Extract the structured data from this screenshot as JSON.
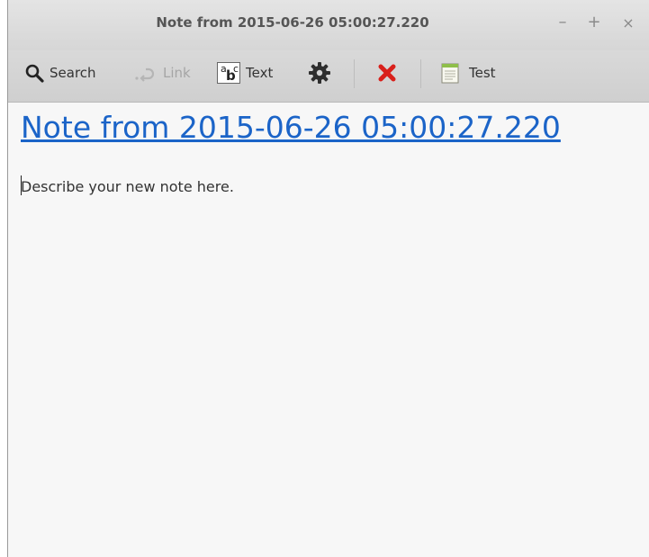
{
  "window": {
    "title": "Note from 2015-06-26 05:00:27.220",
    "controls": {
      "minimize": "–",
      "maximize": "+",
      "close": "×"
    }
  },
  "toolbar": {
    "search_label": "Search",
    "link_label": "Link",
    "text_label": "Text",
    "text_icon_glyphs": {
      "a": "a",
      "b": "b",
      "c": "c"
    },
    "notebook_label": "Test"
  },
  "note": {
    "title": "Note from 2015-06-26 05:00:27.220",
    "body": "Describe your new note here."
  },
  "colors": {
    "link": "#1b64c8",
    "delete": "#d9201b"
  }
}
